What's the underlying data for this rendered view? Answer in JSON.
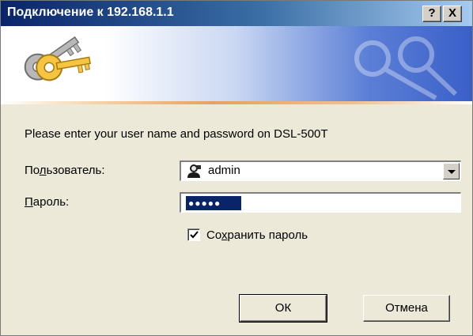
{
  "window": {
    "title": "Подключение к 192.168.1.1",
    "help_label": "?",
    "close_label": "X"
  },
  "prompt": "Please enter your user name and password on DSL-500T",
  "user": {
    "label_pre": "По",
    "label_accel": "л",
    "label_post": "ьзователь:",
    "value": "admin"
  },
  "password": {
    "label_accel": "П",
    "label_post": "ароль:",
    "masked_value": "●●●●●"
  },
  "remember": {
    "label_pre": "Со",
    "label_accel": "х",
    "label_post": "ранить пароль",
    "checked": true
  },
  "buttons": {
    "ok_label": "ОК",
    "cancel_label": "Отмена"
  },
  "icons": {
    "banner": "keys-icon",
    "user": "user-icon",
    "dropdown": "chevron-down-icon",
    "check": "checkmark-icon"
  },
  "colors": {
    "title_start": "#0a246a",
    "title_end": "#a6caf0",
    "dialog_bg": "#ece9d8",
    "selection": "#0a246a"
  }
}
